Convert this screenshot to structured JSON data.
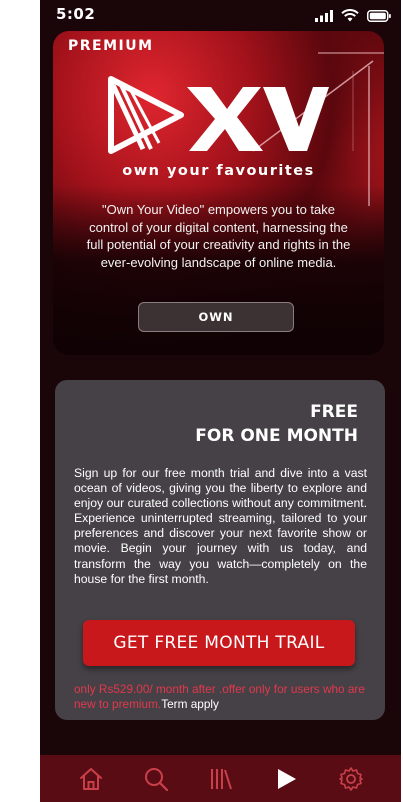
{
  "status": {
    "time": "5:02"
  },
  "hero": {
    "badge": "PREMIUM",
    "logo_text": "XV",
    "tagline": "own your favourites",
    "description": "\"Own Your Video\" empowers you to take control of your digital content, harnessing the full potential of your creativity and rights in the ever-evolving landscape of online media.",
    "own_label": "OWN"
  },
  "offer": {
    "title_line1": "FREE",
    "title_line2": "FOR ONE MONTH",
    "text": "Sign up for our free month trial and dive into a vast ocean of videos, giving you the liberty to explore and enjoy our curated collections without any commitment. Experience uninterrupted streaming, tailored to your preferences and discover your next favorite show or movie. Begin your journey with us today, and transform the way you watch—completely on the house for the first month.",
    "button_label": "GET FREE MONTH TRAIL",
    "note": "only Rs529.00/ month after .offer only for users who are new to premium.",
    "term_link": "Term apply"
  },
  "nav": {
    "items": [
      "home-icon",
      "search-icon",
      "library-icon",
      "play-icon",
      "gear-icon"
    ]
  },
  "colors": {
    "background": "#1a0508",
    "accent": "#c8181b",
    "card": "#454146",
    "nav": "#5a0c14",
    "note": "#e2384d"
  }
}
